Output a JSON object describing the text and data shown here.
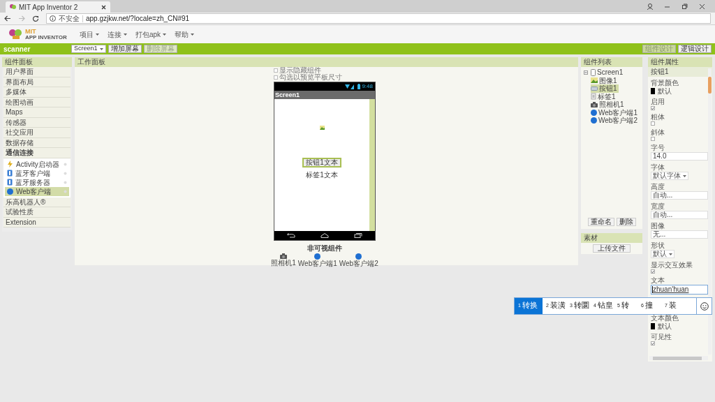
{
  "browser": {
    "tab_title": "MIT App Inventor 2",
    "security": "不安全",
    "url": "app.gzjkw.net/?locale=zh_CN#91"
  },
  "header": {
    "logo_text": "MIT",
    "logo_subtext": "APP INVENTOR",
    "menu": [
      "项目",
      "连接",
      "打包apk",
      "帮助"
    ]
  },
  "toolbar": {
    "project": "scanner",
    "screen": "Screen1",
    "buttons": [
      {
        "label": "增加屏幕",
        "disabled": false
      },
      {
        "label": "删除屏幕",
        "disabled": true
      }
    ],
    "views": [
      {
        "label": "组件设计",
        "selected": true
      },
      {
        "label": "逻辑设计",
        "selected": false
      }
    ]
  },
  "palette": {
    "title": "组件面板",
    "categories": [
      {
        "label": "用户界面",
        "expanded": false
      },
      {
        "label": "界面布局",
        "expanded": false
      },
      {
        "label": "多媒体",
        "expanded": false
      },
      {
        "label": "绘图动画",
        "expanded": false
      },
      {
        "label": "Maps",
        "expanded": false
      },
      {
        "label": "传感器",
        "expanded": false
      },
      {
        "label": "社交应用",
        "expanded": false
      },
      {
        "label": "数据存储",
        "expanded": false
      },
      {
        "label": "通信连接",
        "expanded": true,
        "children": [
          {
            "label": "Activity启动器",
            "kind": "activity",
            "selected": false
          },
          {
            "label": "蓝牙客户端",
            "kind": "bluetooth",
            "selected": false
          },
          {
            "label": "蓝牙服务器",
            "kind": "bluetooth",
            "selected": false
          },
          {
            "label": "Web客户端",
            "kind": "web",
            "selected": true
          }
        ]
      },
      {
        "label": "乐高机器人®",
        "expanded": false
      },
      {
        "label": "试验性质",
        "expanded": false
      },
      {
        "label": "Extension",
        "expanded": false
      }
    ]
  },
  "viewer": {
    "title": "工作面板",
    "options": [
      {
        "label": "显示隐藏组件",
        "checked": false
      },
      {
        "label": "勾选以预览平板尺寸",
        "checked": false
      }
    ],
    "phone": {
      "time": "9:48",
      "screen_title": "Screen1",
      "button": "按钮1文本",
      "label": "标签1文本"
    },
    "nonvisible_title": "非可视组件",
    "nonvisible": [
      {
        "label": "照相机1",
        "kind": "camera"
      },
      {
        "label": "Web客户端1",
        "kind": "web"
      },
      {
        "label": "Web客户端2",
        "kind": "web"
      }
    ]
  },
  "components": {
    "title": "组件列表",
    "tree": [
      {
        "label": "Screen1",
        "kind": "screen",
        "selected": false,
        "expanded": true,
        "children": [
          {
            "label": "图像1",
            "kind": "image",
            "selected": false
          },
          {
            "label": "按钮1",
            "kind": "button",
            "selected": true
          },
          {
            "label": "标签1",
            "kind": "label",
            "selected": false
          },
          {
            "label": "照相机1",
            "kind": "camera",
            "selected": false
          },
          {
            "label": "Web客户端1",
            "kind": "web",
            "selected": false
          },
          {
            "label": "Web客户端2",
            "kind": "web",
            "selected": false
          }
        ]
      }
    ],
    "buttons": [
      "重命名",
      "删除"
    ]
  },
  "media": {
    "title": "素材",
    "button": "上传文件"
  },
  "properties": {
    "title": "组件属性",
    "component": "按钮1",
    "items": [
      {
        "label": "背景颜色",
        "kind": "color",
        "color": "#000000",
        "value": "默认"
      },
      {
        "label": "启用",
        "kind": "checkbox",
        "checked": true
      },
      {
        "label": "粗体",
        "kind": "checkbox",
        "checked": false
      },
      {
        "label": "斜体",
        "kind": "checkbox",
        "checked": false
      },
      {
        "label": "字号",
        "kind": "textbox",
        "value": "14.0"
      },
      {
        "label": "字体",
        "kind": "dropdown",
        "value": "默认字体"
      },
      {
        "label": "高度",
        "kind": "textbox",
        "value": "自动..."
      },
      {
        "label": "宽度",
        "kind": "textbox",
        "value": "自动..."
      },
      {
        "label": "图像",
        "kind": "textbox",
        "value": "无..."
      },
      {
        "label": "形状",
        "kind": "dropdown",
        "value": "默认"
      },
      {
        "label": "显示交互效果",
        "kind": "checkbox",
        "checked": true
      },
      {
        "label": "文本",
        "kind": "composing",
        "value": "zhuan'huan"
      }
    ],
    "items_below": [
      {
        "label": "文本颜色",
        "kind": "color",
        "color": "#000000",
        "value": "默认"
      },
      {
        "label": "可见性",
        "kind": "checkbox",
        "checked": true
      }
    ]
  },
  "ime": {
    "candidates": [
      {
        "number": "1",
        "text": "转换",
        "selected": true
      },
      {
        "number": "2",
        "text": "装潢",
        "selected": false
      },
      {
        "number": "3",
        "text": "转圜",
        "selected": false
      },
      {
        "number": "4",
        "text": "钻皇",
        "selected": false
      },
      {
        "number": "5",
        "text": "转",
        "selected": false
      },
      {
        "number": "6",
        "text": "撞",
        "selected": false
      },
      {
        "number": "7",
        "text": "装",
        "selected": false
      }
    ]
  }
}
